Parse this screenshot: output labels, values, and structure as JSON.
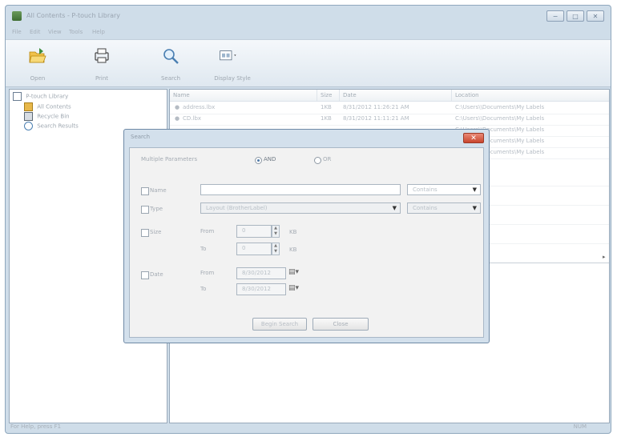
{
  "window": {
    "title": "All Contents - P-touch Library",
    "controls": [
      "−",
      "□",
      "✕"
    ]
  },
  "menu": [
    "File",
    "Edit",
    "View",
    "Tools",
    "Help"
  ],
  "toolbar": {
    "open": "Open",
    "print": "Print",
    "search": "Search",
    "display_style": "Display Style"
  },
  "tree": {
    "root": "P-touch Library",
    "items": [
      "All Contents",
      "Recycle Bin",
      "Search Results"
    ]
  },
  "list": {
    "headers": [
      "Name",
      "Size",
      "Date",
      "Location"
    ],
    "rows": [
      {
        "name": "address.lbx",
        "size": "1KB",
        "date": "8/31/2012 11:26:21 AM",
        "location": "C:\\Users\\\\Documents\\My Labels"
      },
      {
        "name": "CD.lbx",
        "size": "1KB",
        "date": "8/31/2012 11:11:21 AM",
        "location": "C:\\Users\\\\Documents\\My Labels"
      },
      {
        "name": "",
        "size": "",
        "date": "",
        "location": "C:\\Users\\\\Documents\\My Labels"
      },
      {
        "name": "",
        "size": "",
        "date": "",
        "location": "C:\\Users\\\\Documents\\My Labels"
      },
      {
        "name": "",
        "size": "",
        "date": "",
        "location": "C:\\Users\\\\Documents\\My Labels"
      }
    ]
  },
  "dialog": {
    "title": "Search",
    "multiple_parameters_label": "Multiple Parameters",
    "and_label": "AND",
    "or_label": "OR",
    "name_label": "Name",
    "name_value": "",
    "name_mode": "Contains",
    "type_label": "Type",
    "type_value": "Layout (BrotherLabel)",
    "type_mode": "Contains",
    "size_label": "Size",
    "size_from_label": "From",
    "size_from_value": "0",
    "size_to_label": "To",
    "size_to_value": "0",
    "size_unit": "KB",
    "date_label": "Date",
    "date_from_label": "From",
    "date_from_value": "8/30/2012",
    "date_to_label": "To",
    "date_to_value": "8/30/2012",
    "begin_search": "Begin Search",
    "close": "Close"
  },
  "status": {
    "left": "For Help, press F1",
    "right": "NUM"
  }
}
